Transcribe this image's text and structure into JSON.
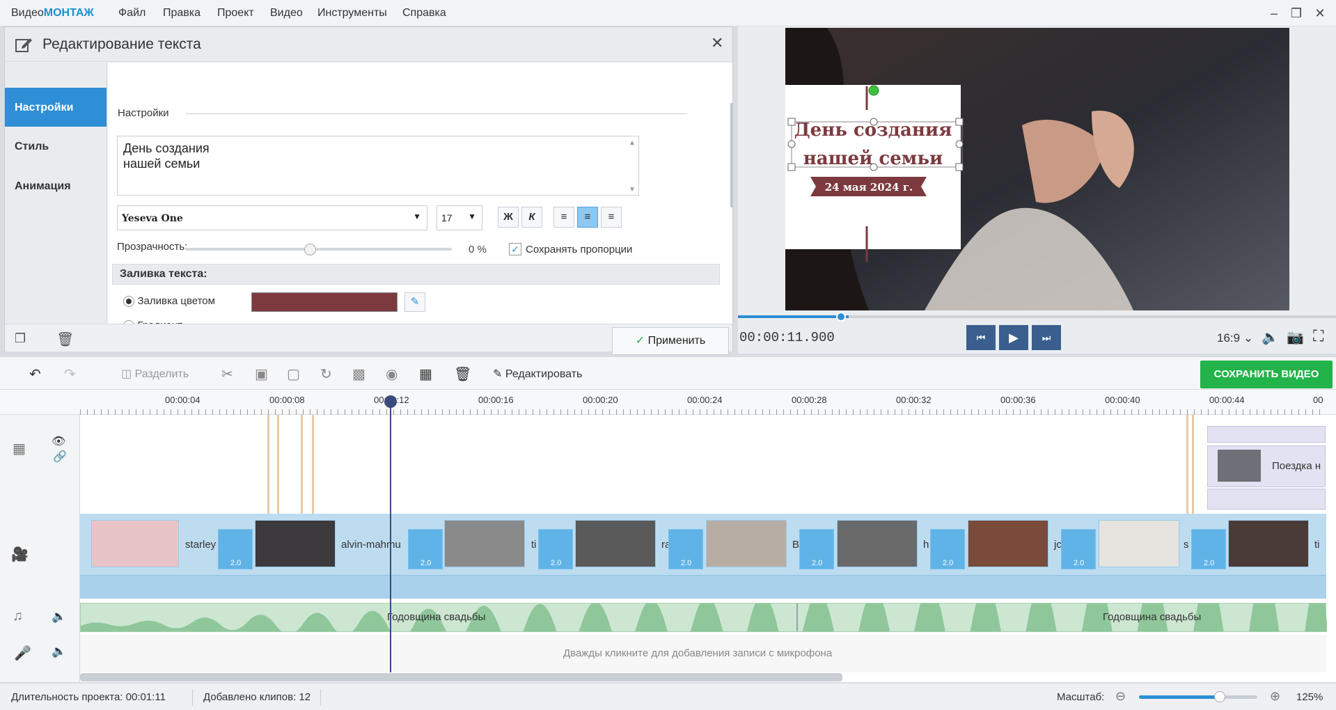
{
  "app": {
    "title_prefix": "Видео",
    "title_brand": "МОНТАЖ"
  },
  "menu": [
    "Файл",
    "Правка",
    "Проект",
    "Видео",
    "Инструменты",
    "Справка"
  ],
  "panel": {
    "title": "Редактирование текста",
    "tabs": [
      "Настройки",
      "Стиль",
      "Анимация"
    ],
    "section_title": "Настройки",
    "text_value": "День создания\nнашей семьи",
    "font": "Yeseva One",
    "font_size": "17",
    "bold_label": "Ж",
    "italic_label": "К",
    "opacity_label": "Прозрачность:",
    "opacity_value": "0 %",
    "opacity_level": 0,
    "keep_proportions_label": "Сохранять пропорции",
    "keep_proportions_checked": true,
    "fill_header": "Заливка текста:",
    "fill_color_label": "Заливка цветом",
    "gradient_label": "Градиент",
    "fill_color": "#7c3a3f",
    "apply_label": "Применить"
  },
  "preview": {
    "title_line1": "День создания",
    "title_line2": "нашей семьи",
    "date_text": "24 мая 2024 г.",
    "timecode": "00:00:11.900",
    "aspect": "16:9",
    "progress": 0.185
  },
  "toolbar": {
    "split_label": "Разделить",
    "edit_label": "Редактировать",
    "save_label": "СОХРАНИТЬ ВИДЕО"
  },
  "ruler_ticks": [
    "00:00:04",
    "00:00:08",
    "00:00:12",
    "00:00:16",
    "00:00:20",
    "00:00:24",
    "00:00:28",
    "00:00:32",
    "00:00:36",
    "00:00:40",
    "00:00:44",
    "00"
  ],
  "clip_labels": [
    "starley",
    "alvin-mahmu",
    "ti",
    "ra",
    "B",
    "h",
    "jc",
    "s",
    "ti"
  ],
  "transition_value": "2.0",
  "overlay_clip_label": "Поездка н",
  "audio": {
    "track1": "Годовщина свадьбы",
    "track2": "Годовщина свадьбы"
  },
  "mic_hint": "Дважды кликните для добавления записи с микрофона",
  "status": {
    "duration": "Длительность проекта:  00:01:11",
    "clips": "Добавлено клипов: 12",
    "scale_label": "Масштаб:",
    "zoom": "125%"
  }
}
